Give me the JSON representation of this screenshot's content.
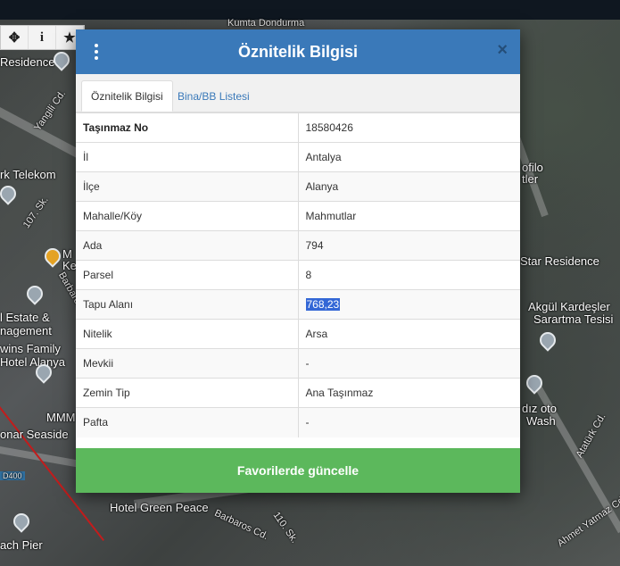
{
  "map": {
    "top_label": "Kumta Dondurma",
    "labels": [
      "Residence",
      "Yangili Cd.",
      "rk Telekom",
      "107. Sk.",
      "M",
      "Ke",
      "Barbaros Cd.",
      "l Estate &",
      "nagement",
      "wins Family",
      "Hotel Alanya",
      "MMM",
      "onar Seaside",
      "D400",
      "Hotel Green Peace",
      "Barbaros Cd.",
      "110. Sk.",
      "ach Pier",
      "ofilo",
      "tler",
      "Star Residence",
      "Akgül Kardeşler",
      "Sarartma Tesisi",
      "dız oto",
      "Wash",
      "Atatürk Cd.",
      "Ahmet Yatmaz Cd."
    ],
    "toolbar": [
      {
        "icon": "move-icon",
        "glyph": "✥"
      },
      {
        "icon": "info-icon",
        "glyph": "i"
      },
      {
        "icon": "star-icon",
        "glyph": "★"
      }
    ]
  },
  "modal": {
    "title": "Öznitelik Bilgisi",
    "close_glyph": "×",
    "tabs": [
      {
        "label": "Öznitelik Bilgisi",
        "active": true
      },
      {
        "label": "Bina/BB Listesi",
        "active": false
      }
    ],
    "rows": [
      {
        "key": "Taşınmaz No",
        "value": "18580426"
      },
      {
        "key": "İl",
        "value": "Antalya"
      },
      {
        "key": "İlçe",
        "value": "Alanya"
      },
      {
        "key": "Mahalle/Köy",
        "value": "Mahmutlar"
      },
      {
        "key": "Ada",
        "value": "794"
      },
      {
        "key": "Parsel",
        "value": "8"
      },
      {
        "key": "Tapu Alanı",
        "value": "768,23"
      },
      {
        "key": "Nitelik",
        "value": "Arsa"
      },
      {
        "key": "Mevkii",
        "value": "-"
      },
      {
        "key": "Zemin Tip",
        "value": "Ana Taşınmaz"
      },
      {
        "key": "Pafta",
        "value": "-"
      }
    ],
    "button_label": "Favorilerde güncelle"
  },
  "colors": {
    "header": "#3a79b9",
    "button": "#5cb85c",
    "selection": "#3367d6"
  }
}
